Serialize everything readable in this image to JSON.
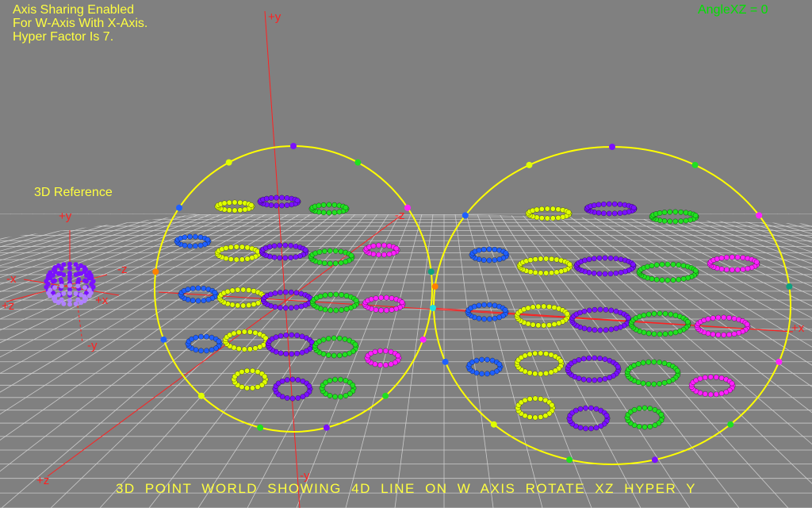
{
  "overlay": {
    "info_lines": [
      "Axis Sharing Enabled",
      "For W-Axis With X-Axis.",
      "Hyper Factor Is 7."
    ],
    "angle_readout": "AngleXZ = 0",
    "reference_title": "3D Reference",
    "caption": "3D POINT WORLD SHOWING 4D LINE ON W AXIS ROTATE XZ HYPER Y"
  },
  "axis_labels": {
    "plus_y": "+y",
    "minus_y": "-y",
    "plus_x": "+x",
    "minus_z": "-z",
    "plus_z": "+z"
  },
  "reference_axes": {
    "plus_y": "+y",
    "minus_y": "-y",
    "plus_x": "+x",
    "minus_x": "-x",
    "plus_z": "+z",
    "minus_z": "-z"
  },
  "colors": {
    "background": "#808080",
    "grid": "#d8d8d8",
    "axis": "#ff2020",
    "circle": "#ffff00",
    "text_yellow": "#ffff40",
    "text_green": "#00e000",
    "blue": "#2060ff",
    "yellow": "#e0ff00",
    "purple": "#7a10ff",
    "green": "#20e020",
    "magenta": "#ff20ff",
    "orange": "#ff8000",
    "cyan": "#20e0e0",
    "teal": "#10a080"
  }
}
